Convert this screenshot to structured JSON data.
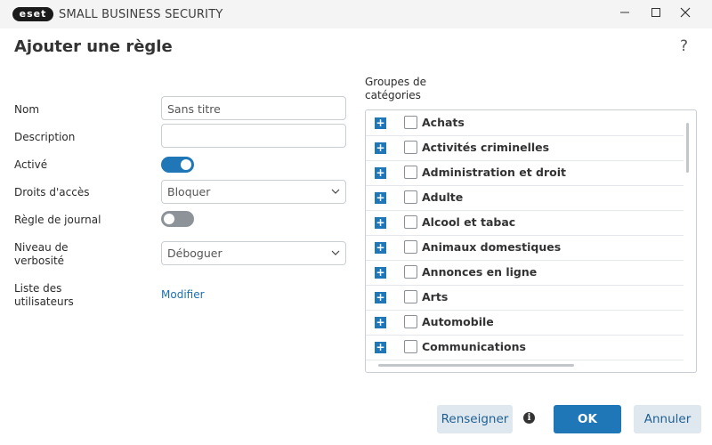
{
  "window": {
    "logo_text": "eset",
    "app_name": "SMALL BUSINESS SECURITY",
    "minimize_glyph": "—",
    "maximize_glyph": "□",
    "close_glyph": "✕"
  },
  "dialog": {
    "title": "Ajouter une règle",
    "help_glyph": "?"
  },
  "form": {
    "name_label": "Nom",
    "name_value": "Sans titre",
    "description_label": "Description",
    "description_value": "",
    "active_label": "Activé",
    "active_on": true,
    "access_label": "Droits d'accès",
    "access_value": "Bloquer",
    "log_label": "Règle de journal",
    "log_on": false,
    "verbosity_label": "Niveau de verbosité",
    "verbosity_value": "Déboguer",
    "users_label": "Liste des utilisateurs",
    "users_link": "Modifier"
  },
  "categories": {
    "label": "Groupes de catégories",
    "items": [
      {
        "label": "Achats",
        "checked": false
      },
      {
        "label": "Activités criminelles",
        "checked": false
      },
      {
        "label": "Administration et droit",
        "checked": false
      },
      {
        "label": "Adulte",
        "checked": false
      },
      {
        "label": "Alcool et tabac",
        "checked": false
      },
      {
        "label": "Animaux domestiques",
        "checked": false
      },
      {
        "label": "Annonces en ligne",
        "checked": false
      },
      {
        "label": "Arts",
        "checked": false
      },
      {
        "label": "Automobile",
        "checked": false
      },
      {
        "label": "Communications",
        "checked": false
      }
    ]
  },
  "footer": {
    "renseigner_label": "Renseigner",
    "info_glyph": "i",
    "ok_label": "OK",
    "cancel_label": "Annuler"
  },
  "colors": {
    "accent": "#1f77b8",
    "toggle_off": "#8e9399",
    "link": "#1a6fb5"
  }
}
